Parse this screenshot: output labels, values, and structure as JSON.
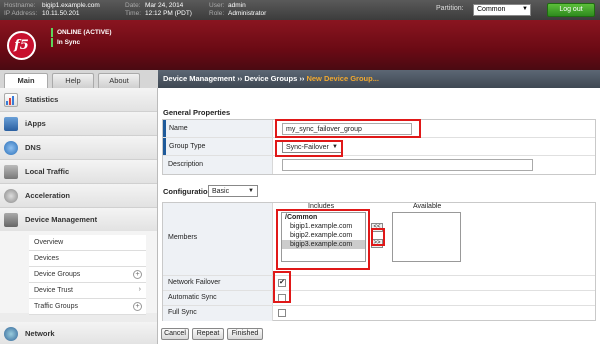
{
  "topbar": {
    "hostname_label": "Hostname:",
    "hostname": "bigip1.example.com",
    "ip_label": "IP Address:",
    "ip": "10.11.50.201",
    "date_label": "Date:",
    "date": "Mar 24, 2014",
    "time_label": "Time:",
    "time": "12:12 PM (PDT)",
    "user_label": "User:",
    "user": "admin",
    "role_label": "Role:",
    "role": "Administrator",
    "partition_label": "Partition:",
    "partition_value": "Common",
    "logout_label": "Log out"
  },
  "header": {
    "logo_text": "f5",
    "status_line1": "ONLINE (ACTIVE)",
    "status_line2": "In Sync",
    "status_color": "#5cd65c"
  },
  "tabs": [
    {
      "label": "Main",
      "active": true
    },
    {
      "label": "Help",
      "active": false
    },
    {
      "label": "About",
      "active": false
    }
  ],
  "sidebar": {
    "items": [
      {
        "label": "Statistics",
        "icon": "statistics-icon"
      },
      {
        "label": "iApps",
        "icon": "iapps-icon"
      },
      {
        "label": "DNS",
        "icon": "dns-icon"
      },
      {
        "label": "Local Traffic",
        "icon": "local-traffic-icon"
      },
      {
        "label": "Acceleration",
        "icon": "acceleration-icon"
      },
      {
        "label": "Device Management",
        "icon": "device-management-icon"
      },
      {
        "label": "Network",
        "icon": "network-icon"
      }
    ],
    "subitems": [
      {
        "label": "Overview"
      },
      {
        "label": "Devices"
      },
      {
        "label": "Device Groups"
      },
      {
        "label": "Device Trust"
      },
      {
        "label": "Traffic Groups"
      }
    ]
  },
  "breadcrumb": {
    "part1": "Device Management",
    "sep": "››",
    "part2": "Device Groups",
    "current": "New Device Group..."
  },
  "general": {
    "title": "General Properties",
    "name_label": "Name",
    "name_value": "my_sync_failover_group",
    "type_label": "Group Type",
    "type_value": "Sync-Failover",
    "desc_label": "Description",
    "desc_value": ""
  },
  "configuration": {
    "label": "Configuration:",
    "mode": "Basic",
    "members_label": "Members",
    "includes_header": "Includes",
    "available_header": "Available",
    "includes_group": "/Common",
    "includes": [
      "bigip1.example.com",
      "bigip2.example.com",
      "bigip3.example.com"
    ],
    "available": [],
    "move_left": "<<",
    "move_right": ">>",
    "network_failover_label": "Network Failover",
    "network_failover_mark": "✔",
    "network_failover_checked": true,
    "auto_sync_label": "Automatic Sync",
    "auto_sync_checked": false,
    "full_sync_label": "Full Sync",
    "full_sync_checked": false
  },
  "actions": {
    "cancel": "Cancel",
    "repeat": "Repeat",
    "finished": "Finished"
  },
  "colors": {
    "brand_red": "#c8102e",
    "highlight_red": "#e01818",
    "breadcrumb_current": "#f0a830"
  }
}
